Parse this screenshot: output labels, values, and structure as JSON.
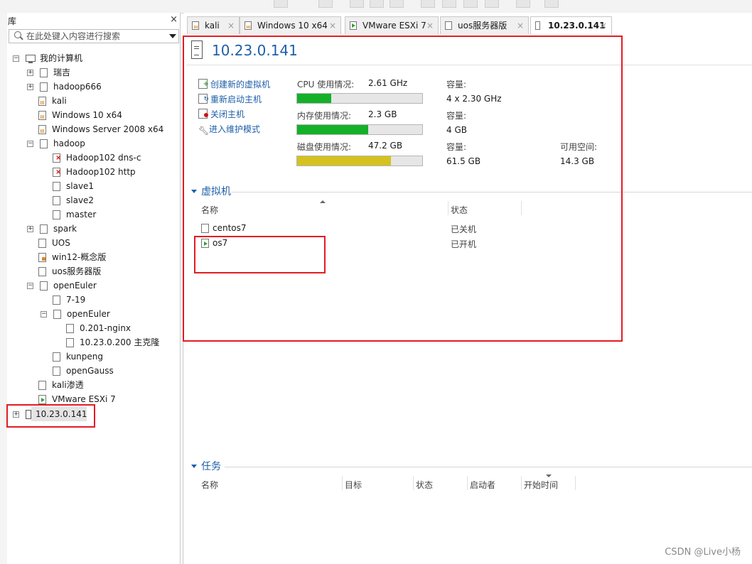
{
  "library": {
    "title": "库",
    "close": "×",
    "search_placeholder": "在此处键入内容进行搜索",
    "tree": [
      {
        "label": "我的计算机",
        "expander": "⊟"
      },
      {
        "label": "瑞吉",
        "expander": "⊞"
      },
      {
        "label": "hadoop666",
        "expander": "⊞"
      },
      {
        "label": "kali"
      },
      {
        "label": "Windows 10 x64"
      },
      {
        "label": "Windows Server 2008 x64"
      },
      {
        "label": "hadoop",
        "expander": "⊟"
      },
      {
        "label": "Hadoop102 dns-c"
      },
      {
        "label": "Hadoop102 http"
      },
      {
        "label": "slave1"
      },
      {
        "label": "slave2"
      },
      {
        "label": "master"
      },
      {
        "label": "spark",
        "expander": "⊞"
      },
      {
        "label": "UOS"
      },
      {
        "label": "win12-概念版"
      },
      {
        "label": "uos服务器版"
      },
      {
        "label": "openEuler",
        "expander": "⊟"
      },
      {
        "label": "7-19"
      },
      {
        "label": "openEuler",
        "expander": "⊟"
      },
      {
        "label": "0.201-nginx"
      },
      {
        "label": "10.23.0.200 主克隆"
      },
      {
        "label": "kunpeng"
      },
      {
        "label": "openGauss"
      },
      {
        "label": "kali渗透"
      },
      {
        "label": "VMware ESXi 7"
      },
      {
        "label": "10.23.0.141",
        "expander": "⊞",
        "selected": true
      }
    ]
  },
  "tabs": [
    {
      "label": "kali",
      "icon": "vm-chart-icon",
      "close": "×"
    },
    {
      "label": "Windows 10 x64",
      "icon": "vm-chart-icon",
      "close": "×"
    },
    {
      "label": "VMware ESXi 7",
      "icon": "vm-play-icon",
      "close": "×"
    },
    {
      "label": "uos服务器版",
      "icon": "vm-stack-icon",
      "close": "×"
    },
    {
      "label": "10.23.0.141",
      "icon": "server-icon",
      "close": "×",
      "active": true
    }
  ],
  "host": {
    "title": "10.23.0.141",
    "commands": [
      "创建新的虚拟机",
      "重新启动主机",
      "关闭主机",
      "进入维护模式"
    ],
    "cpu": {
      "label": "CPU 使用情况:",
      "value": "2.61 GHz",
      "cap_label": "容量:",
      "cap_value": "4 x 2.30 GHz",
      "usage_fraction": 0.27
    },
    "mem": {
      "label": "内存使用情况:",
      "value": "2.3 GB",
      "cap_label": "容量:",
      "cap_value": "4 GB",
      "usage_fraction": 0.57
    },
    "disk": {
      "label": "磁盘使用情况:",
      "value": "47.2 GB",
      "cap_label": "容量:",
      "cap_value": "61.5 GB",
      "free_label": "可用空间:",
      "free_value": "14.3 GB",
      "usage_fraction": 0.75
    }
  },
  "vms_section": {
    "title": "虚拟机",
    "columns": [
      "名称",
      "状态"
    ],
    "rows": [
      {
        "name": "centos7",
        "state": "已关机"
      },
      {
        "name": "os7",
        "state": "已开机"
      }
    ]
  },
  "tasks_section": {
    "title": "任务",
    "columns": [
      "名称",
      "目标",
      "状态",
      "启动者",
      "开始时间"
    ]
  },
  "watermark": "CSDN @Live小杨",
  "colors": {
    "accent": "#1e5fa8",
    "green_bar": "#14b02a",
    "yellow_bar": "#d4c220",
    "highlight": "#e31b23"
  }
}
